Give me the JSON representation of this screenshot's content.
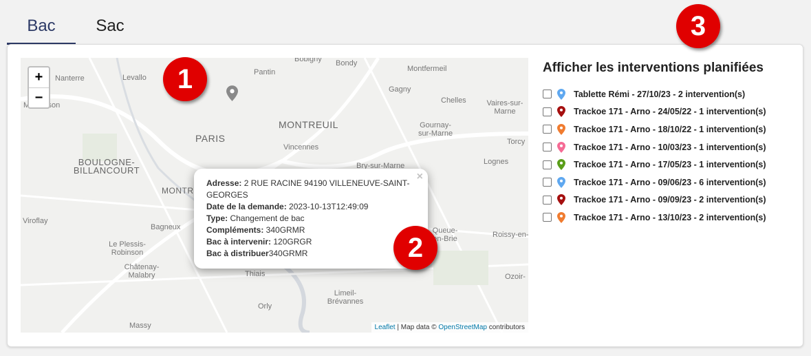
{
  "tabs": [
    {
      "label": "Bac",
      "active": true
    },
    {
      "label": "Sac",
      "active": false
    }
  ],
  "map": {
    "zoom_in": "+",
    "zoom_out": "−",
    "labels": [
      "Nanterre",
      "Levallo",
      "Pantin",
      "Bobigny",
      "Bondy",
      "Montfermeil",
      "Gagny",
      "Chelles",
      "Vaires-sur-Marne",
      "Malmaison",
      "PARIS",
      "MONTREUIL",
      "Vincennes",
      "Gournay-sur-Marne",
      "Torcy",
      "BOULOGNE-BILLANCOURT",
      "Bry-sur-Marne",
      "Lognes",
      "MONTROUGE",
      "Viroflay",
      "Bagneux",
      "Le Plessis-Robinson",
      "Châtenay-Malabry",
      "Thiais",
      "Orly",
      "Limeil-Brévannes",
      "Massy",
      "Ozoir-",
      "Roissy-en-",
      "Queue-en-Brie"
    ],
    "attribution": {
      "leaflet": "Leaflet",
      "sep": " | Map data © ",
      "osm": "OpenStreetMap",
      "suffix": " contributors"
    },
    "marker_color": "#8a8a8a"
  },
  "popup": {
    "close": "×",
    "rows": [
      {
        "label": "Adresse:",
        "value": " 2 RUE RACINE 94190 VILLENEUVE-SAINT-GEORGES"
      },
      {
        "label": "Date de la demande:",
        "value": " 2023-10-13T12:49:09"
      },
      {
        "label": "Type:",
        "value": " Changement de bac"
      },
      {
        "label": "Compléments:",
        "value": " 340GRMR"
      },
      {
        "label": "Bac à intervenir:",
        "value": " 120GRGR"
      },
      {
        "label": "Bac à distribuer",
        "value": "340GRMR"
      }
    ]
  },
  "sidebar": {
    "title": "Afficher les interventions planifiées",
    "items": [
      {
        "label": "Tablette Rémi - 27/10/23 - 2 intervention(s)",
        "color": "#5fa8f0",
        "checked": false
      },
      {
        "label": "Trackoe 171 - Arno - 24/05/22 - 1 intervention(s)",
        "color": "#a50f0f",
        "checked": false
      },
      {
        "label": "Trackoe 171 - Arno - 18/10/22 - 1 intervention(s)",
        "color": "#f07c30",
        "checked": false
      },
      {
        "label": "Trackoe 171 - Arno - 10/03/23 - 1 intervention(s)",
        "color": "#f56b95",
        "checked": false
      },
      {
        "label": "Trackoe 171 - Arno - 17/05/23 - 1 intervention(s)",
        "color": "#5a9e1a",
        "checked": false
      },
      {
        "label": "Trackoe 171 - Arno - 09/06/23 - 6 intervention(s)",
        "color": "#5fa8f0",
        "checked": false
      },
      {
        "label": "Trackoe 171 - Arno - 09/09/23 - 2 intervention(s)",
        "color": "#a50f0f",
        "checked": false
      },
      {
        "label": "Trackoe 171 - Arno - 13/10/23 - 2 intervention(s)",
        "color": "#f07c30",
        "checked": false
      }
    ]
  },
  "badges": [
    "1",
    "2",
    "3"
  ],
  "badge_color": "#e00000"
}
